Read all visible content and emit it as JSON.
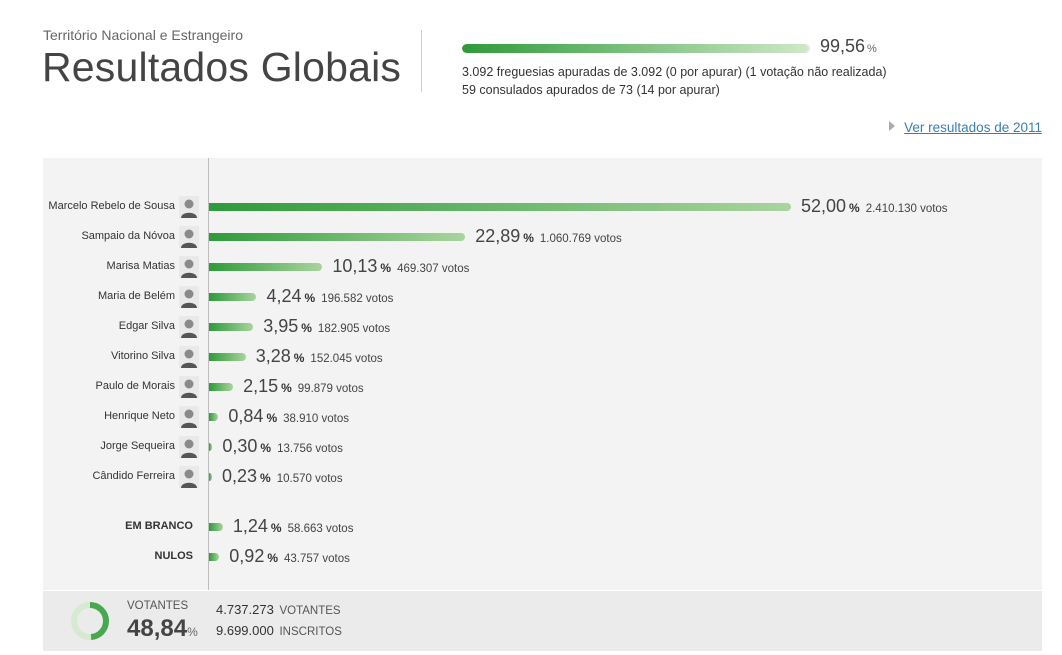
{
  "header": {
    "subtitle": "Território Nacional e Estrangeiro",
    "title": "Resultados Globais"
  },
  "progress": {
    "value": "99,56",
    "unit": "%",
    "fraction": 0.9956,
    "line1": "3.092 freguesias apuradas de 3.092 (0 por apurar)  (1 votação não realizada)",
    "line2": "59 consulados apurados de 73 (14 por apurar)"
  },
  "link": {
    "label": "Ver resultados de 2011"
  },
  "colors": {
    "bar_start": "#2e9a3a",
    "bar_end": "#a9d49e",
    "panel": "#f3f3f3"
  },
  "chart_data": {
    "type": "bar",
    "orientation": "horizontal",
    "categories": [
      "Marcelo Rebelo de Sousa",
      "Sampaio da Nóvoa",
      "Marisa Matias",
      "Maria de Belém",
      "Edgar Silva",
      "Vitorino Silva",
      "Paulo de Morais",
      "Henrique Neto",
      "Jorge Sequeira",
      "Cândido Ferreira",
      "EM BRANCO",
      "NULOS"
    ],
    "values": [
      52.0,
      22.89,
      10.13,
      4.24,
      3.95,
      3.28,
      2.15,
      0.84,
      0.3,
      0.23,
      1.24,
      0.92
    ],
    "value_labels": [
      "52,00",
      "22,89",
      "10,13",
      "4,24",
      "3,95",
      "3,28",
      "2,15",
      "0,84",
      "0,30",
      "0,23",
      "1,24",
      "0,92"
    ],
    "votes": [
      "2.410.130 votos",
      "1.060.769 votos",
      "469.307 votos",
      "196.582 votos",
      "182.905 votos",
      "152.045 votos",
      "99.879 votos",
      "38.910 votos",
      "13.756 votos",
      "10.570 votos",
      "58.663 votos",
      "43.757 votos"
    ],
    "unit": "%",
    "xlim": [
      0,
      100
    ]
  },
  "footer": {
    "votantes_label": "VOTANTES",
    "turnout": "48,84",
    "turnout_fraction": 0.4884,
    "turnout_unit": "%",
    "votantes_value": "4.737.273",
    "votantes_unit": "VOTANTES",
    "inscritos_value": "9.699.000",
    "inscritos_unit": "INSCRITOS"
  }
}
